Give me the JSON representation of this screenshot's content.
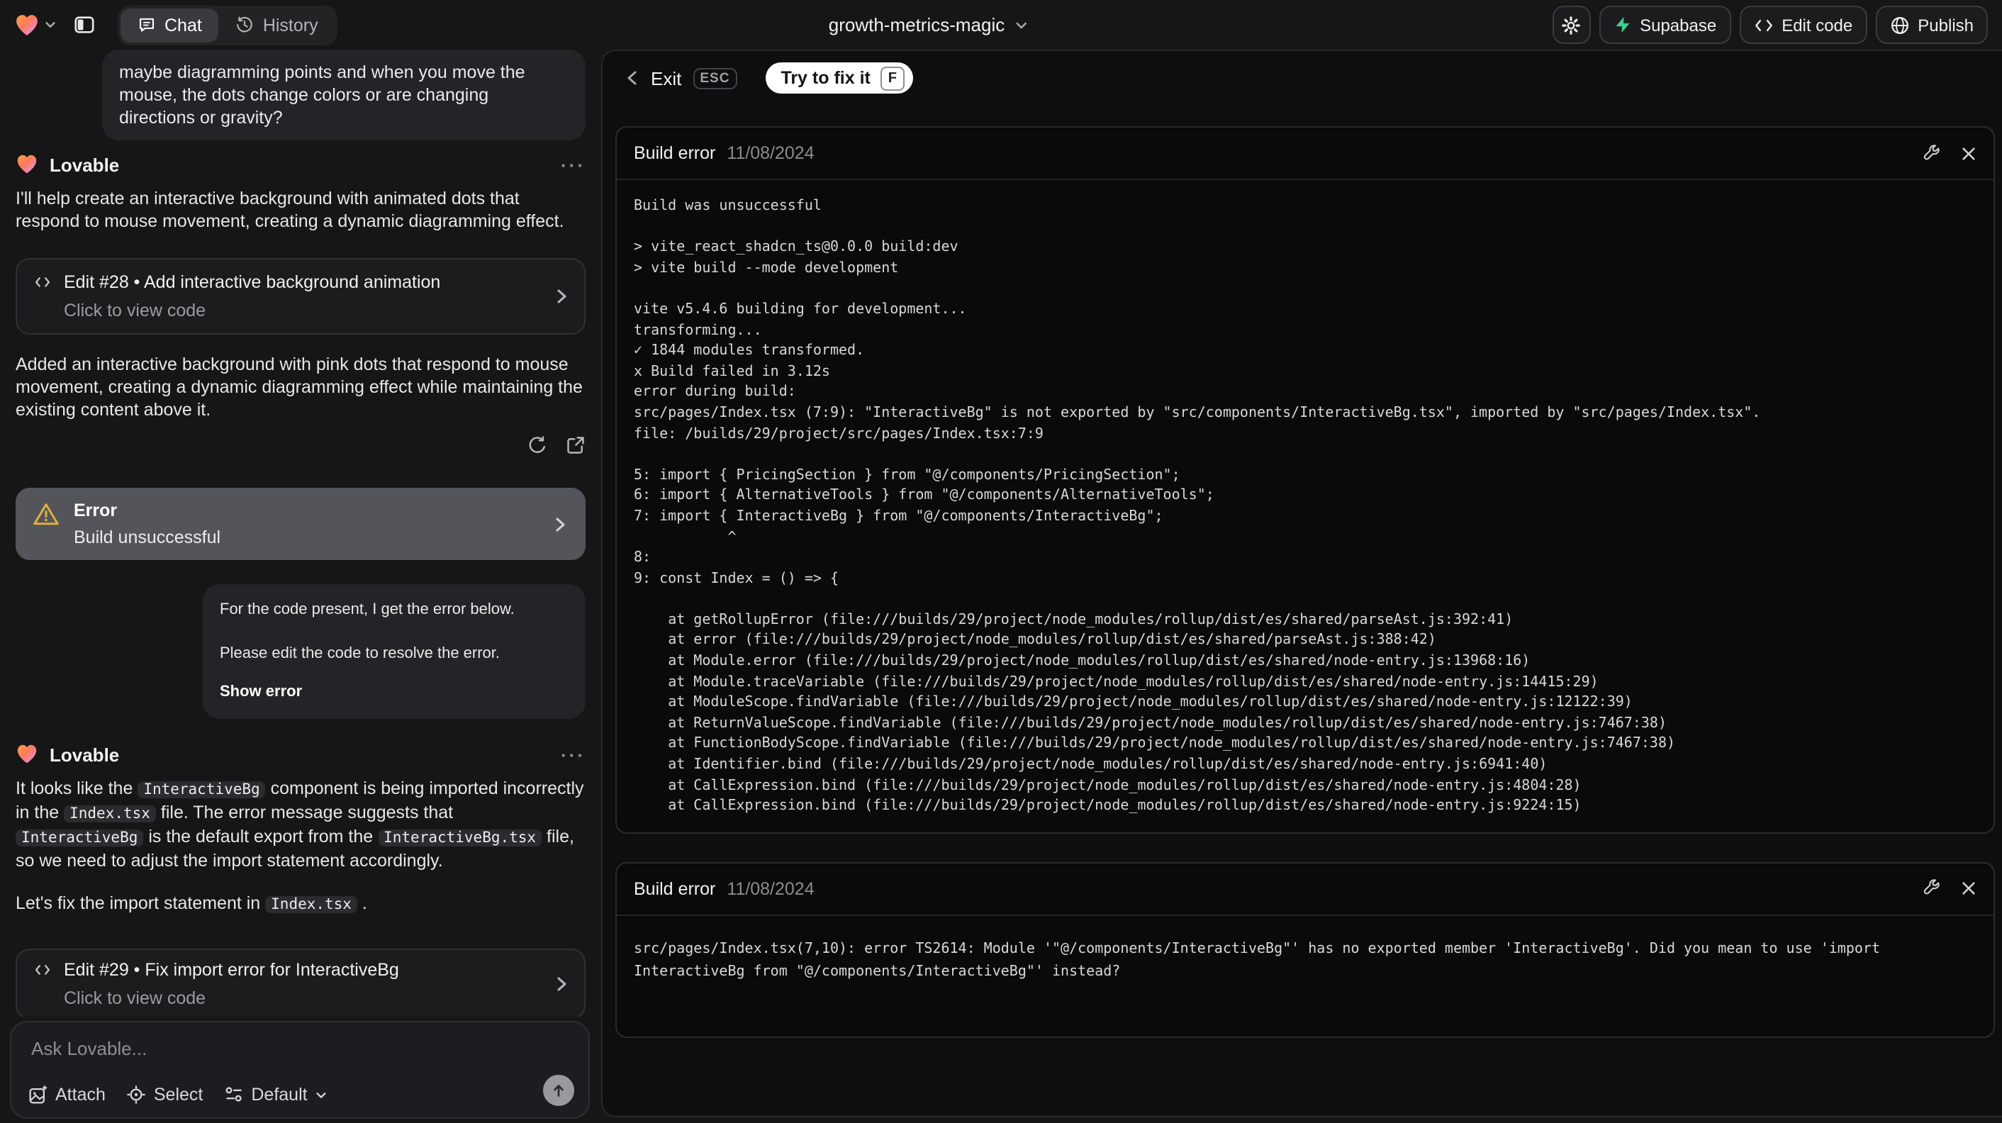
{
  "topbar": {
    "tabs": [
      {
        "label": "Chat"
      },
      {
        "label": "History"
      }
    ],
    "project_name": "growth-metrics-magic",
    "actions": {
      "supabase": "Supabase",
      "edit_code": "Edit code",
      "publish": "Publish"
    }
  },
  "chat": {
    "assistant_name": "Lovable",
    "user_message_1": "maybe diagramming points and when you move the mouse, the dots change colors or are changing directions or gravity?",
    "assistant_message_1": "I'll help create an interactive background with animated dots that respond to mouse movement, creating a dynamic diagramming effect.",
    "edit_card_28": {
      "title": "Edit #28 • Add interactive background animation",
      "subtitle": "Click to view code"
    },
    "assistant_message_1b": "Added an interactive background with pink dots that respond to mouse movement, creating a dynamic diagramming effect while maintaining the existing content above it.",
    "error_card": {
      "title": "Error",
      "subtitle": "Build unsuccessful"
    },
    "user_message_2": {
      "line1": "For the code present, I get the error below.",
      "line2": "Please edit the code to resolve the error.",
      "link": "Show error"
    },
    "assistant_message_2_segments": [
      {
        "t": "text",
        "v": "It looks like the "
      },
      {
        "t": "code",
        "v": "InteractiveBg"
      },
      {
        "t": "text",
        "v": " component is being imported incorrectly in the "
      },
      {
        "t": "code",
        "v": "Index.tsx"
      },
      {
        "t": "text",
        "v": " file. The error message suggests that "
      },
      {
        "t": "code",
        "v": "InteractiveBg"
      },
      {
        "t": "text",
        "v": " is the default export from the "
      },
      {
        "t": "code",
        "v": "InteractiveBg.tsx"
      },
      {
        "t": "text",
        "v": " file, so we need to adjust the import statement accordingly."
      }
    ],
    "assistant_message_2b_segments": [
      {
        "t": "text",
        "v": "Let's fix the import statement in "
      },
      {
        "t": "code",
        "v": "Index.tsx"
      },
      {
        "t": "text",
        "v": " ."
      }
    ],
    "edit_card_29": {
      "title": "Edit #29 • Fix import error for InteractiveBg",
      "subtitle": "Click to view code"
    },
    "composer": {
      "placeholder": "Ask Lovable...",
      "attach": "Attach",
      "select": "Select",
      "mode": "Default"
    }
  },
  "error_view": {
    "exit_label": "Exit",
    "esc_key": "ESC",
    "fix_button": "Try to fix it",
    "fix_key": "F",
    "panels": [
      {
        "title": "Build error",
        "date": "11/08/2024",
        "body": "Build was unsuccessful\n\n> vite_react_shadcn_ts@0.0.0 build:dev\n> vite build --mode development\n\nvite v5.4.6 building for development...\ntransforming...\n✓ 1844 modules transformed.\nx Build failed in 3.12s\nerror during build:\nsrc/pages/Index.tsx (7:9): \"InteractiveBg\" is not exported by \"src/components/InteractiveBg.tsx\", imported by \"src/pages/Index.tsx\".\nfile: /builds/29/project/src/pages/Index.tsx:7:9\n\n5: import { PricingSection } from \"@/components/PricingSection\";\n6: import { AlternativeTools } from \"@/components/AlternativeTools\";\n7: import { InteractiveBg } from \"@/components/InteractiveBg\";\n           ^\n8:\n9: const Index = () => {\n\n    at getRollupError (file:///builds/29/project/node_modules/rollup/dist/es/shared/parseAst.js:392:41)\n    at error (file:///builds/29/project/node_modules/rollup/dist/es/shared/parseAst.js:388:42)\n    at Module.error (file:///builds/29/project/node_modules/rollup/dist/es/shared/node-entry.js:13968:16)\n    at Module.traceVariable (file:///builds/29/project/node_modules/rollup/dist/es/shared/node-entry.js:14415:29)\n    at ModuleScope.findVariable (file:///builds/29/project/node_modules/rollup/dist/es/shared/node-entry.js:12122:39)\n    at ReturnValueScope.findVariable (file:///builds/29/project/node_modules/rollup/dist/es/shared/node-entry.js:7467:38)\n    at FunctionBodyScope.findVariable (file:///builds/29/project/node_modules/rollup/dist/es/shared/node-entry.js:7467:38)\n    at Identifier.bind (file:///builds/29/project/node_modules/rollup/dist/es/shared/node-entry.js:6941:40)\n    at CallExpression.bind (file:///builds/29/project/node_modules/rollup/dist/es/shared/node-entry.js:4804:28)\n    at CallExpression.bind (file:///builds/29/project/node_modules/rollup/dist/es/shared/node-entry.js:9224:15)"
      },
      {
        "title": "Build error",
        "date": "11/08/2024",
        "body": "src/pages/Index.tsx(7,10): error TS2614: Module '\"@/components/InteractiveBg\"' has no exported member 'InteractiveBg'. Did you mean to use 'import InteractiveBg from \"@/components/InteractiveBg\"' instead?"
      }
    ]
  },
  "icons": {
    "heart-logo": "gradient heart",
    "warning": "amber triangle with exclamation",
    "colors": {
      "supabase_green": "#3ecf8e",
      "warning_amber": "#deb03c",
      "accent_white_button": "#ffffff"
    }
  }
}
